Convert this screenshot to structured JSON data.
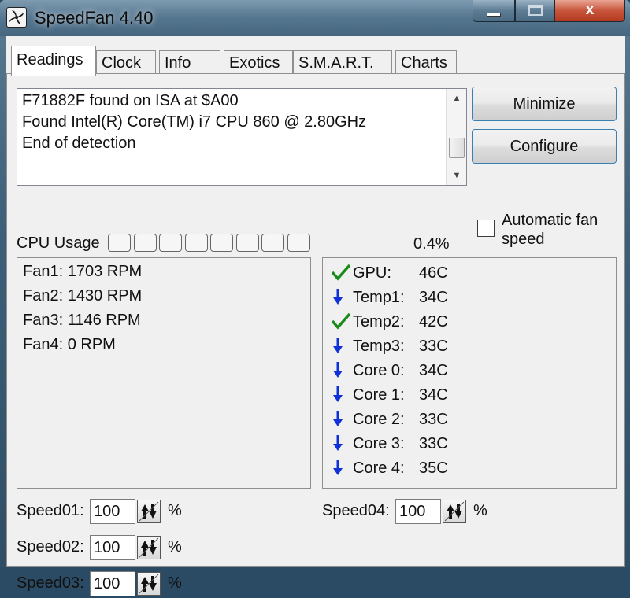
{
  "window": {
    "title": "SpeedFan 4.40",
    "controls": [
      "minimize",
      "maximize",
      "close"
    ],
    "close_glyph": "x"
  },
  "tabs": [
    {
      "label": "Readings",
      "active": true
    },
    {
      "label": "Clock",
      "active": false
    },
    {
      "label": "Info",
      "active": false
    },
    {
      "label": "Exotics",
      "active": false
    },
    {
      "label": "S.M.A.R.T.",
      "active": false
    },
    {
      "label": "Charts",
      "active": false
    }
  ],
  "log": {
    "lines": [
      "F71882F found on ISA at $A00",
      "Found Intel(R) Core(TM) i7 CPU 860 @ 2.80GHz",
      "End of detection"
    ]
  },
  "buttons": {
    "minimize": "Minimize",
    "configure": "Configure"
  },
  "auto_fan": {
    "label_line1": "Automatic fan",
    "label_line2": "speed",
    "checked": false
  },
  "cpu_usage": {
    "label": "CPU Usage",
    "cells": 8,
    "value": "0.4%"
  },
  "fans": [
    "Fan1: 1703 RPM",
    "Fan2: 1430 RPM",
    "Fan3: 1146 RPM",
    "Fan4: 0 RPM"
  ],
  "temps": [
    {
      "name": "GPU:",
      "value": "46C",
      "icon": "check-icon",
      "color": "#1a8a1a"
    },
    {
      "name": "Temp1:",
      "value": "34C",
      "icon": "arrow-down-icon",
      "color": "#1030d8"
    },
    {
      "name": "Temp2:",
      "value": "42C",
      "icon": "check-icon",
      "color": "#1a8a1a"
    },
    {
      "name": "Temp3:",
      "value": "33C",
      "icon": "arrow-down-icon",
      "color": "#1030d8"
    },
    {
      "name": "Core 0:",
      "value": "34C",
      "icon": "arrow-down-icon",
      "color": "#1030d8"
    },
    {
      "name": "Core 1:",
      "value": "34C",
      "icon": "arrow-down-icon",
      "color": "#1030d8"
    },
    {
      "name": "Core 2:",
      "value": "33C",
      "icon": "arrow-down-icon",
      "color": "#1030d8"
    },
    {
      "name": "Core 3:",
      "value": "33C",
      "icon": "arrow-down-icon",
      "color": "#1030d8"
    },
    {
      "name": "Core 4:",
      "value": "35C",
      "icon": "arrow-down-icon",
      "color": "#1030d8"
    }
  ],
  "speeds": [
    {
      "label": "Speed01:",
      "value": "100",
      "unit": "%"
    },
    {
      "label": "Speed02:",
      "value": "100",
      "unit": "%"
    },
    {
      "label": "Speed03:",
      "value": "100",
      "unit": "%"
    },
    {
      "label": "Speed04:",
      "value": "100",
      "unit": "%"
    }
  ]
}
